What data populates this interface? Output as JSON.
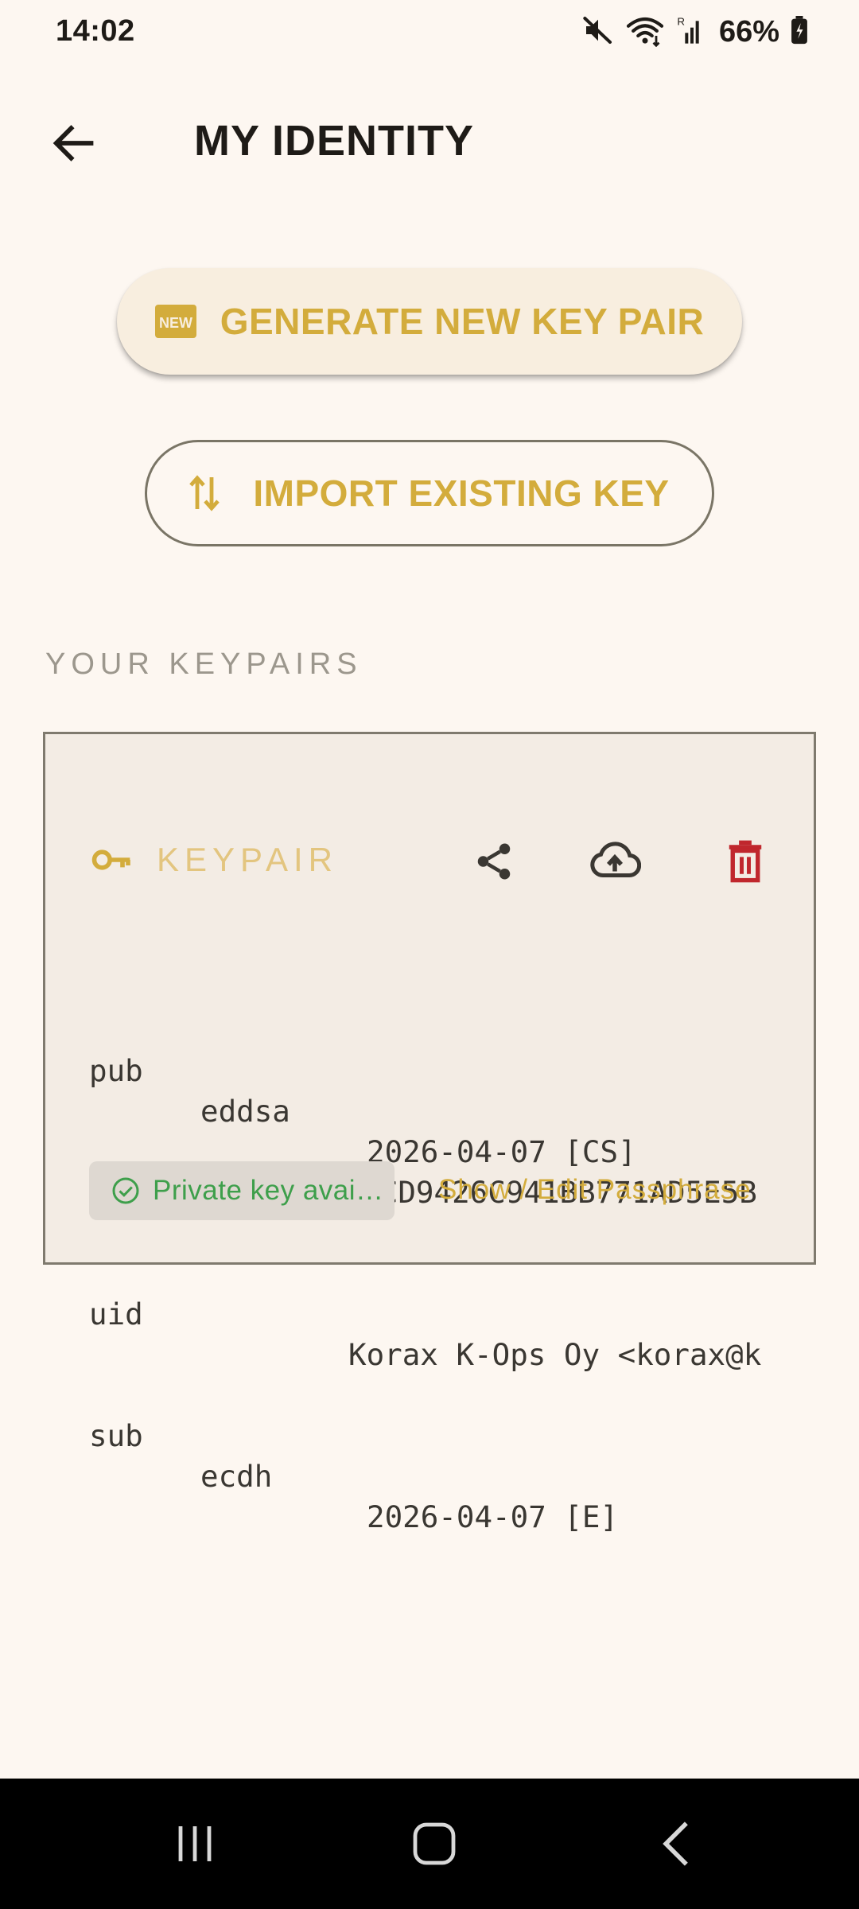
{
  "status_bar": {
    "time": "14:02",
    "battery_percent": "66%",
    "icons": [
      "mute-icon",
      "wifi-icon",
      "signal-icon",
      "battery-icon"
    ]
  },
  "app_bar": {
    "title": "MY IDENTITY",
    "back_icon": "arrow-back-icon"
  },
  "actions": {
    "generate_label": "GENERATE NEW KEY PAIR",
    "generate_icon": "new-badge-icon",
    "import_label": "IMPORT EXISTING KEY",
    "import_icon": "swap-vertical-icon"
  },
  "section": {
    "title": "YOUR KEYPAIRS"
  },
  "keypair": {
    "title": "KEYPAIR",
    "icons": [
      "key-icon",
      "share-icon",
      "cloud-upload-icon",
      "delete-icon"
    ],
    "pub": {
      "label": "pub",
      "algo": "eddsa",
      "date_flags": "2026-04-07 [CS]"
    },
    "fingerprint": "9C12836721CD9426C941BB771AD5E5B",
    "uid": {
      "label": "uid",
      "value": "Korax K-Ops Oy <korax@k"
    },
    "sub": {
      "label": "sub",
      "algo": "ecdh",
      "date_flags": "2026-04-07 [E]"
    },
    "private_badge": "Private key avai…",
    "passphrase_link": "Show / Edit Passphrase"
  },
  "colors": {
    "background": "#FDF7F1",
    "accent": "#D3AC3C",
    "card": "#F3ECE4",
    "delete": "#C0272D",
    "success": "#3E9F4B"
  },
  "nav_bar": {
    "icons": [
      "recents-icon",
      "home-icon",
      "back-nav-icon"
    ]
  }
}
